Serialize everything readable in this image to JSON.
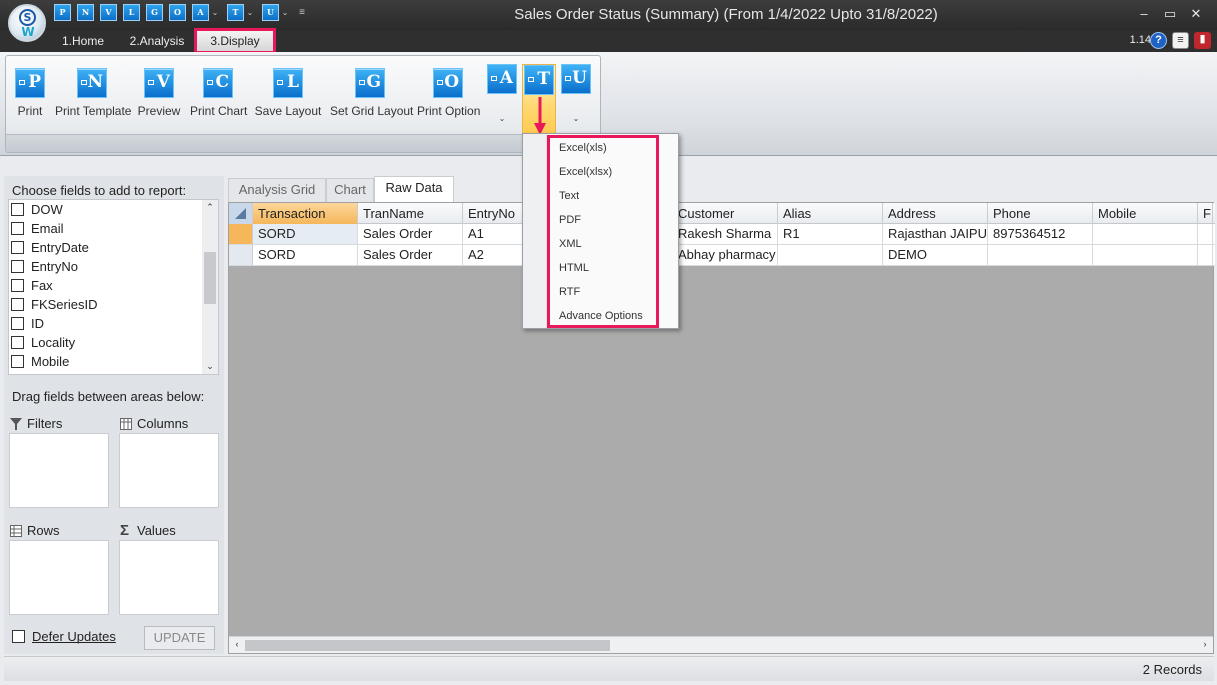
{
  "window": {
    "title": "Sales Order Status (Summary)  (From 1/4/2022 Upto 31/8/2022)",
    "version": "1.14",
    "controls": [
      "–",
      "▭",
      "✕"
    ]
  },
  "quick_access": [
    "P",
    "N",
    "V",
    "L",
    "G",
    "O",
    "A",
    "T",
    "U"
  ],
  "tabs": [
    "1.Home",
    "2.Analysis",
    "3.Display"
  ],
  "ribbon": {
    "buttons": [
      {
        "letter": "P",
        "label": "Print"
      },
      {
        "letter": "N",
        "label": "Print Template"
      },
      {
        "letter": "V",
        "label": "Preview"
      },
      {
        "letter": "C",
        "label": "Print Chart"
      },
      {
        "letter": "L",
        "label": "Save Layout"
      },
      {
        "letter": "G",
        "label": "Set Grid Layout"
      },
      {
        "letter": "O",
        "label": "Print Option"
      }
    ],
    "small_buttons": [
      "A",
      "T",
      "U"
    ],
    "dropdown_arrow": "⌄"
  },
  "export_menu": {
    "items": [
      "Excel(xls)",
      "Excel(xlsx)",
      "Text",
      "PDF",
      "XML",
      "HTML",
      "RTF",
      "Advance Options"
    ]
  },
  "field_panel": {
    "choose_label": "Choose fields to add to report:",
    "fields": [
      "DOW",
      "Email",
      "EntryDate",
      "EntryNo",
      "Fax",
      "FKSeriesID",
      "ID",
      "Locality",
      "Mobile"
    ],
    "drag_label": "Drag fields between areas below:",
    "areas": {
      "filters": "Filters",
      "columns": "Columns",
      "rows": "Rows",
      "values": "Values"
    },
    "defer_label": "Defer Updates",
    "update_label": "UPDATE"
  },
  "grid": {
    "tabs": [
      "Analysis Grid",
      "Chart",
      "Raw Data"
    ],
    "columns": [
      "Transaction",
      "TranName",
      "EntryNo",
      "",
      "Customer",
      "Alias",
      "Address",
      "Phone",
      "Mobile",
      "F"
    ],
    "rows": [
      [
        "SORD",
        "Sales Order",
        "A1",
        "",
        "Rakesh Sharma",
        "R1",
        "Rajasthan  JAIPUR",
        "8975364512",
        "",
        ""
      ],
      [
        "SORD",
        "Sales Order",
        "A2",
        "",
        "Abhay pharmacy",
        "",
        " DEMO",
        "",
        "",
        ""
      ]
    ]
  },
  "status": {
    "records": "2 Records"
  },
  "colors": {
    "highlight": "#e8195a",
    "accent_blue": "#0a6fcc",
    "active_header": "#f5b75a"
  }
}
